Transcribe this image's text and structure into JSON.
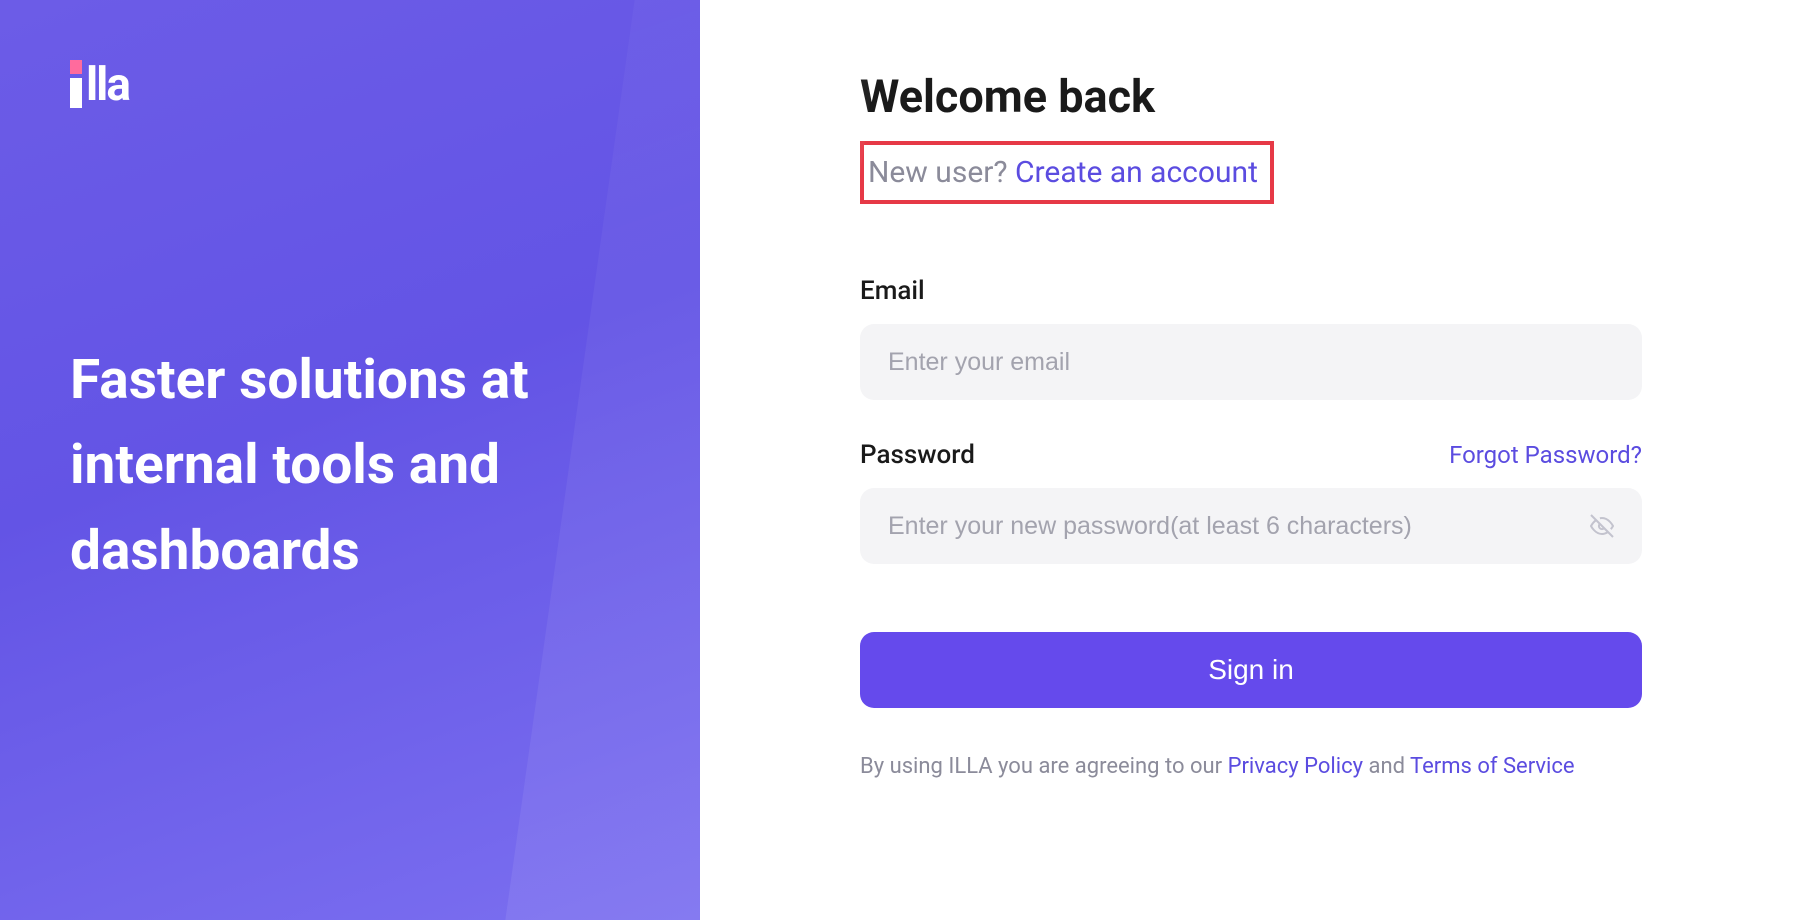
{
  "left": {
    "logo_text": "lla",
    "tagline": "Faster solutions at internal tools and dashboards"
  },
  "form": {
    "heading": "Welcome back",
    "new_user_prompt": "New user? ",
    "create_account": "Create an account",
    "email_label": "Email",
    "email_placeholder": "Enter your email",
    "password_label": "Password",
    "password_placeholder": "Enter your new password(at least 6 characters)",
    "forgot_password": "Forgot Password?",
    "signin_button": "Sign in"
  },
  "terms": {
    "prefix": "By using ILLA you are agreeing to our ",
    "privacy": "Privacy Policy",
    "and": " and ",
    "tos": "Terms of Service"
  }
}
